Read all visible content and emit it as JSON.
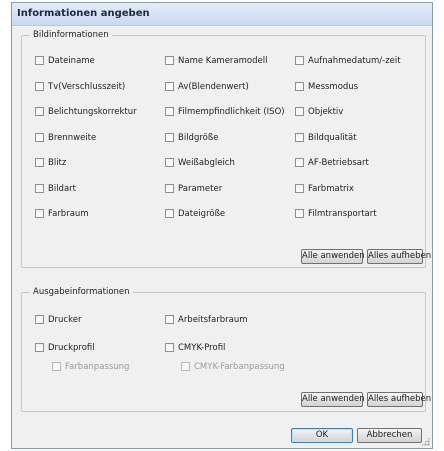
{
  "window": {
    "title": "Informationen angeben"
  },
  "image_info": {
    "legend": "Bildinformationen",
    "items": [
      "Dateiname",
      "Name Kameramodell",
      "Aufnahmedatum/-zeit",
      "Tv(Verschlusszeit)",
      "Av(Blendenwert)",
      "Messmodus",
      "Belichtungskorrektur",
      "Filmempfindlichkeit (ISO)",
      "Objektiv",
      "Brennweite",
      "Bildgröße",
      "Bildqualität",
      "Blitz",
      "Weißabgleich",
      "AF-Betriebsart",
      "Bildart",
      "Parameter",
      "Farbmatrix",
      "Farbraum",
      "Dateigröße",
      "Filmtransportart"
    ],
    "apply_all_label": "Alle anwenden",
    "clear_all_label": "Alles aufheben"
  },
  "output_info": {
    "legend": "Ausgabeinformationen",
    "printer": "Drucker",
    "workspace": "Arbeitsfarbraum",
    "print_profile": "Druckprofil",
    "cmyk_profile": "CMYK-Profil",
    "color_matching": "Farbanpassung",
    "cmyk_color_matching": "CMYK-Farbanpassung",
    "apply_all_label": "Alle anwenden",
    "clear_all_label": "Alles aufheben"
  },
  "footer": {
    "ok_label": "OK",
    "cancel_label": "Abbrechen"
  }
}
